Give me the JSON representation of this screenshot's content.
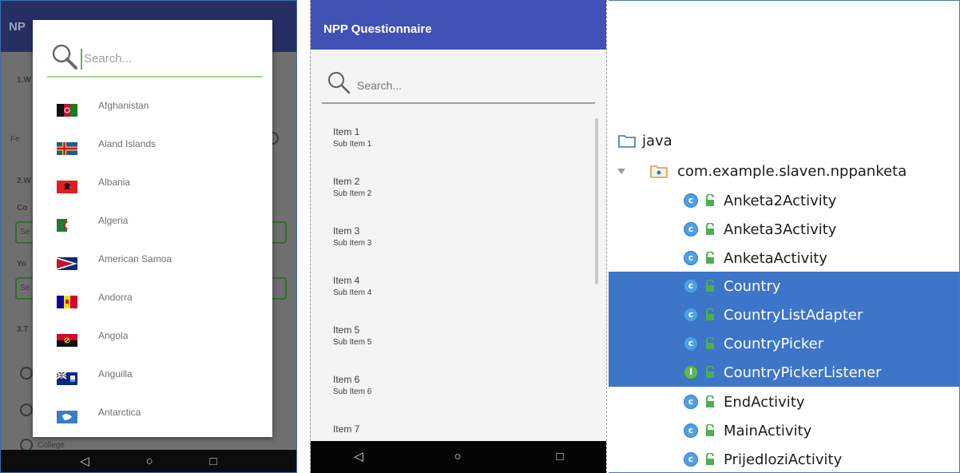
{
  "panel1": {
    "background_title": "NP",
    "background_labels": [
      "1.W",
      "Fe",
      "2.W",
      "Co",
      "Yo",
      "3.T",
      "College"
    ],
    "background_field_text": [
      "Se",
      "Se"
    ],
    "search_placeholder": "Search...",
    "countries": [
      {
        "name": "Afghanistan",
        "flag": "afghanistan-flag"
      },
      {
        "name": "Aland Islands",
        "flag": "aland-islands-flag"
      },
      {
        "name": "Albania",
        "flag": "albania-flag"
      },
      {
        "name": "Algeria",
        "flag": "algeria-flag"
      },
      {
        "name": "American Samoa",
        "flag": "american-samoa-flag"
      },
      {
        "name": "Andorra",
        "flag": "andorra-flag"
      },
      {
        "name": "Angola",
        "flag": "angola-flag"
      },
      {
        "name": "Anguilla",
        "flag": "anguilla-flag"
      },
      {
        "name": "Antarctica",
        "flag": "antarctica-flag"
      }
    ],
    "nav": {
      "back": "◁",
      "home": "○",
      "recents": "□"
    }
  },
  "panel2": {
    "title": "NPP Questionnaire",
    "search_placeholder": "Search...",
    "items": [
      {
        "title": "Item 1",
        "sub": "Sub Item 1"
      },
      {
        "title": "Item 2",
        "sub": "Sub Item 2"
      },
      {
        "title": "Item 3",
        "sub": "Sub Item 3"
      },
      {
        "title": "Item 4",
        "sub": "Sub Item 4"
      },
      {
        "title": "Item 5",
        "sub": "Sub Item 5"
      },
      {
        "title": "Item 6",
        "sub": "Sub Item 6"
      },
      {
        "title": "Item 7",
        "sub": ""
      }
    ],
    "nav": {
      "back": "◁",
      "home": "○",
      "recents": "□"
    }
  },
  "panel3": {
    "root": "java",
    "package": "com.example.slaven.nppanketa",
    "classes": [
      {
        "name": "Anketa2Activity",
        "kind": "C",
        "selected": false
      },
      {
        "name": "Anketa3Activity",
        "kind": "C",
        "selected": false
      },
      {
        "name": "AnketaActivity",
        "kind": "C",
        "selected": false
      },
      {
        "name": "Country",
        "kind": "C",
        "selected": true
      },
      {
        "name": "CountryListAdapter",
        "kind": "C",
        "selected": true
      },
      {
        "name": "CountryPicker",
        "kind": "C",
        "selected": true
      },
      {
        "name": "CountryPickerListener",
        "kind": "I",
        "selected": true
      },
      {
        "name": "EndActivity",
        "kind": "C",
        "selected": false
      },
      {
        "name": "MainActivity",
        "kind": "C",
        "selected": false
      },
      {
        "name": "PrijedloziActivity",
        "kind": "C",
        "selected": false
      }
    ],
    "colors": {
      "selection": "#3d75c8",
      "class_icon": "#4ea0e5",
      "interface_icon": "#5cb85c",
      "lock": "#4caf50"
    }
  }
}
